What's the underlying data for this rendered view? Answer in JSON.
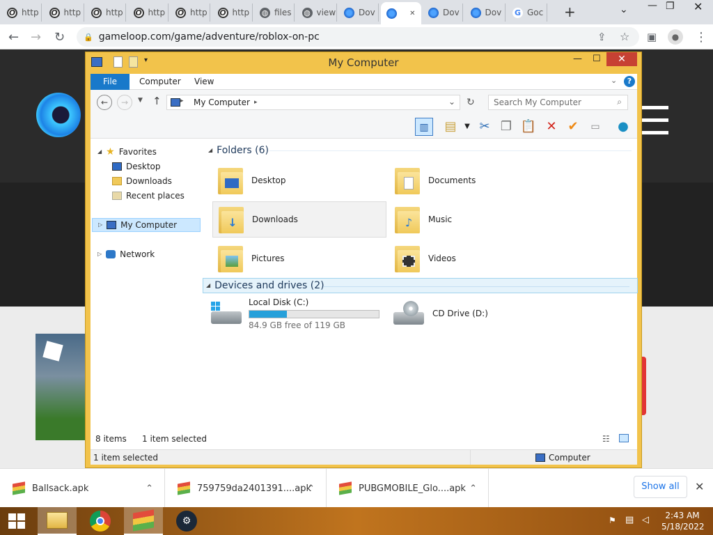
{
  "browser": {
    "tabs": [
      {
        "label": "http",
        "icon": "opera-icon"
      },
      {
        "label": "http",
        "icon": "opera-icon"
      },
      {
        "label": "http",
        "icon": "opera-icon"
      },
      {
        "label": "http",
        "icon": "opera-icon"
      },
      {
        "label": "http",
        "icon": "opera-icon"
      },
      {
        "label": "http",
        "icon": "opera-icon"
      },
      {
        "label": "files",
        "icon": "globe-icon"
      },
      {
        "label": "view",
        "icon": "globe-icon"
      },
      {
        "label": "Dov",
        "icon": "gameloop-icon"
      },
      {
        "label": "",
        "icon": "gameloop-icon"
      },
      {
        "label": "Dov",
        "icon": "gameloop-icon"
      },
      {
        "label": "Dov",
        "icon": "gameloop-icon"
      },
      {
        "label": "Goc",
        "icon": "google-icon"
      }
    ],
    "new_tab": "+",
    "url": "gameloop.com/game/adventure/roblox-on-pc"
  },
  "explorer": {
    "title": "My Computer",
    "ribbon_tabs": [
      "File",
      "Computer",
      "View"
    ],
    "breadcrumb": "My Computer",
    "search_placeholder": "Search My Computer",
    "nav": {
      "favorites": "Favorites",
      "desktop": "Desktop",
      "downloads": "Downloads",
      "recent": "Recent places",
      "my_computer": "My Computer",
      "network": "Network"
    },
    "folders_header": "Folders (6)",
    "folders": [
      "Desktop",
      "Documents",
      "Downloads",
      "Music",
      "Pictures",
      "Videos"
    ],
    "devices_header": "Devices and drives (2)",
    "local_disk": {
      "name": "Local Disk (C:)",
      "free": "84.9 GB free of 119 GB",
      "used_fraction": 0.29
    },
    "cd_drive": "CD Drive (D:)",
    "item_count": "8 items",
    "selected_count": "1 item selected",
    "status_selected": "1 item selected",
    "status_location": "Computer"
  },
  "downloads": [
    {
      "name": "Ballsack.apk"
    },
    {
      "name": "759759da2401391....apk"
    },
    {
      "name": "PUBGMOBILE_Glo....apk"
    }
  ],
  "show_all": "Show all",
  "clock": {
    "time": "2:43 AM",
    "date": "5/18/2022"
  }
}
